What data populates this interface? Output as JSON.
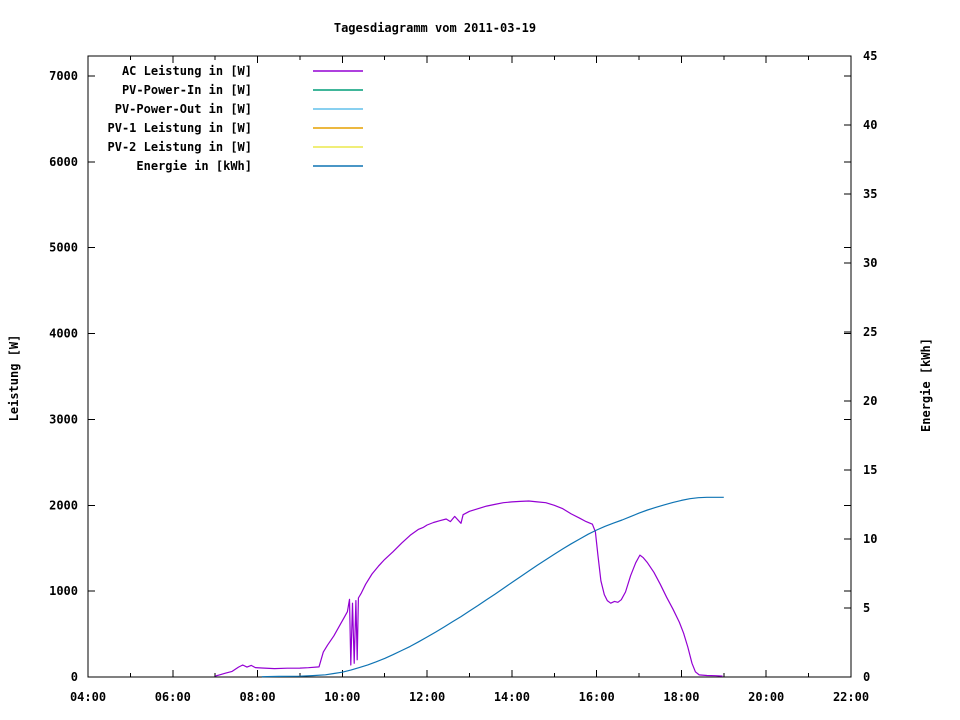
{
  "window": {
    "background": "#ffffff",
    "text_color": "#000000"
  },
  "chart_data": {
    "type": "line",
    "title": "Tagesdiagramm vom 2011-03-19",
    "legend_position": "top-left-inside",
    "grid": false,
    "x_axis": {
      "unit": "time",
      "range_hours": [
        4,
        22
      ],
      "major_ticks": [
        4,
        6,
        8,
        10,
        12,
        14,
        16,
        18,
        20,
        22
      ],
      "major_tick_labels": [
        "04:00",
        "06:00",
        "08:00",
        "10:00",
        "12:00",
        "14:00",
        "16:00",
        "18:00",
        "20:00",
        "22:00"
      ],
      "minor_ticks": [
        5,
        7,
        9,
        11,
        13,
        15,
        17,
        19,
        21
      ]
    },
    "y1_axis": {
      "label": "Leistung [W]",
      "min": 0,
      "max": 7233,
      "ticks": [
        0,
        1000,
        2000,
        3000,
        4000,
        5000,
        6000,
        7000
      ],
      "tick_labels": [
        "0",
        "1000",
        "2000",
        "3000",
        "4000",
        "5000",
        "6000",
        "7000"
      ]
    },
    "y2_axis": {
      "label": "Energie [kWh]",
      "min": 0,
      "max": 45,
      "ticks": [
        0,
        5,
        10,
        15,
        20,
        25,
        30,
        35,
        40,
        45
      ],
      "tick_labels": [
        "0",
        "5",
        "10",
        "15",
        "20",
        "25",
        "30",
        "35",
        "40",
        "45"
      ]
    },
    "series": [
      {
        "name": "AC Leistung in [W]",
        "color": "#9400d3",
        "axis": "y1",
        "points": [
          [
            7.0,
            10
          ],
          [
            7.1,
            25
          ],
          [
            7.25,
            45
          ],
          [
            7.4,
            65
          ],
          [
            7.55,
            115
          ],
          [
            7.65,
            140
          ],
          [
            7.75,
            115
          ],
          [
            7.85,
            135
          ],
          [
            7.95,
            110
          ],
          [
            8.1,
            105
          ],
          [
            8.4,
            98
          ],
          [
            8.7,
            102
          ],
          [
            9.0,
            104
          ],
          [
            9.2,
            108
          ],
          [
            9.45,
            118
          ],
          [
            9.55,
            290
          ],
          [
            9.65,
            370
          ],
          [
            9.8,
            480
          ],
          [
            9.95,
            610
          ],
          [
            10.05,
            700
          ],
          [
            10.12,
            760
          ],
          [
            10.17,
            905
          ],
          [
            10.2,
            140
          ],
          [
            10.24,
            860
          ],
          [
            10.28,
            160
          ],
          [
            10.32,
            890
          ],
          [
            10.35,
            200
          ],
          [
            10.38,
            920
          ],
          [
            10.45,
            980
          ],
          [
            10.55,
            1080
          ],
          [
            10.7,
            1200
          ],
          [
            10.85,
            1290
          ],
          [
            11.0,
            1370
          ],
          [
            11.2,
            1460
          ],
          [
            11.4,
            1560
          ],
          [
            11.6,
            1650
          ],
          [
            11.8,
            1720
          ],
          [
            11.9,
            1740
          ],
          [
            12.0,
            1770
          ],
          [
            12.15,
            1800
          ],
          [
            12.3,
            1820
          ],
          [
            12.45,
            1840
          ],
          [
            12.55,
            1810
          ],
          [
            12.65,
            1870
          ],
          [
            12.8,
            1790
          ],
          [
            12.85,
            1890
          ],
          [
            13.0,
            1930
          ],
          [
            13.2,
            1960
          ],
          [
            13.4,
            1990
          ],
          [
            13.6,
            2010
          ],
          [
            13.8,
            2030
          ],
          [
            14.0,
            2040
          ],
          [
            14.2,
            2045
          ],
          [
            14.4,
            2050
          ],
          [
            14.6,
            2040
          ],
          [
            14.8,
            2030
          ],
          [
            15.0,
            2000
          ],
          [
            15.2,
            1960
          ],
          [
            15.4,
            1900
          ],
          [
            15.6,
            1850
          ],
          [
            15.75,
            1810
          ],
          [
            15.9,
            1780
          ],
          [
            15.97,
            1690
          ],
          [
            16.03,
            1420
          ],
          [
            16.1,
            1120
          ],
          [
            16.18,
            960
          ],
          [
            16.25,
            890
          ],
          [
            16.33,
            860
          ],
          [
            16.42,
            880
          ],
          [
            16.5,
            870
          ],
          [
            16.58,
            900
          ],
          [
            16.68,
            990
          ],
          [
            16.8,
            1180
          ],
          [
            16.92,
            1330
          ],
          [
            17.02,
            1420
          ],
          [
            17.1,
            1390
          ],
          [
            17.2,
            1330
          ],
          [
            17.35,
            1220
          ],
          [
            17.5,
            1080
          ],
          [
            17.65,
            930
          ],
          [
            17.8,
            790
          ],
          [
            17.95,
            640
          ],
          [
            18.05,
            510
          ],
          [
            18.15,
            350
          ],
          [
            18.25,
            160
          ],
          [
            18.33,
            60
          ],
          [
            18.42,
            25
          ],
          [
            18.6,
            18
          ],
          [
            18.8,
            15
          ],
          [
            18.97,
            10
          ]
        ]
      },
      {
        "name": "PV-Power-In in [W]",
        "color": "#009e78",
        "axis": "y1",
        "points": []
      },
      {
        "name": "PV-Power-Out in [W]",
        "color": "#62c1ec",
        "axis": "y1",
        "points": []
      },
      {
        "name": "PV-1 Leistung in [W]",
        "color": "#e6a000",
        "axis": "y1",
        "points": []
      },
      {
        "name": "PV-2 Leistung in [W]",
        "color": "#ebe84b",
        "axis": "y1",
        "points": []
      },
      {
        "name": "Energie in [kWh]",
        "color": "#0f74b4",
        "axis": "y2",
        "points": [
          [
            8.1,
            0.02
          ],
          [
            8.5,
            0.04
          ],
          [
            9.0,
            0.06
          ],
          [
            9.3,
            0.1
          ],
          [
            9.6,
            0.16
          ],
          [
            9.8,
            0.25
          ],
          [
            10.0,
            0.35
          ],
          [
            10.2,
            0.5
          ],
          [
            10.4,
            0.68
          ],
          [
            10.6,
            0.88
          ],
          [
            10.8,
            1.1
          ],
          [
            11.0,
            1.35
          ],
          [
            11.2,
            1.62
          ],
          [
            11.4,
            1.92
          ],
          [
            11.6,
            2.22
          ],
          [
            11.8,
            2.55
          ],
          [
            12.0,
            2.9
          ],
          [
            12.2,
            3.25
          ],
          [
            12.4,
            3.62
          ],
          [
            12.6,
            4.0
          ],
          [
            12.8,
            4.38
          ],
          [
            13.0,
            4.78
          ],
          [
            13.2,
            5.18
          ],
          [
            13.4,
            5.6
          ],
          [
            13.6,
            6.0
          ],
          [
            13.8,
            6.42
          ],
          [
            14.0,
            6.85
          ],
          [
            14.2,
            7.27
          ],
          [
            14.4,
            7.68
          ],
          [
            14.6,
            8.1
          ],
          [
            14.8,
            8.5
          ],
          [
            15.0,
            8.9
          ],
          [
            15.2,
            9.28
          ],
          [
            15.4,
            9.65
          ],
          [
            15.6,
            10.0
          ],
          [
            15.8,
            10.35
          ],
          [
            16.0,
            10.65
          ],
          [
            16.2,
            10.92
          ],
          [
            16.4,
            11.15
          ],
          [
            16.6,
            11.38
          ],
          [
            16.8,
            11.62
          ],
          [
            17.0,
            11.88
          ],
          [
            17.2,
            12.1
          ],
          [
            17.4,
            12.3
          ],
          [
            17.6,
            12.48
          ],
          [
            17.8,
            12.65
          ],
          [
            18.0,
            12.8
          ],
          [
            18.2,
            12.92
          ],
          [
            18.4,
            12.99
          ],
          [
            18.6,
            13.02
          ],
          [
            19.0,
            13.02
          ]
        ]
      }
    ]
  }
}
